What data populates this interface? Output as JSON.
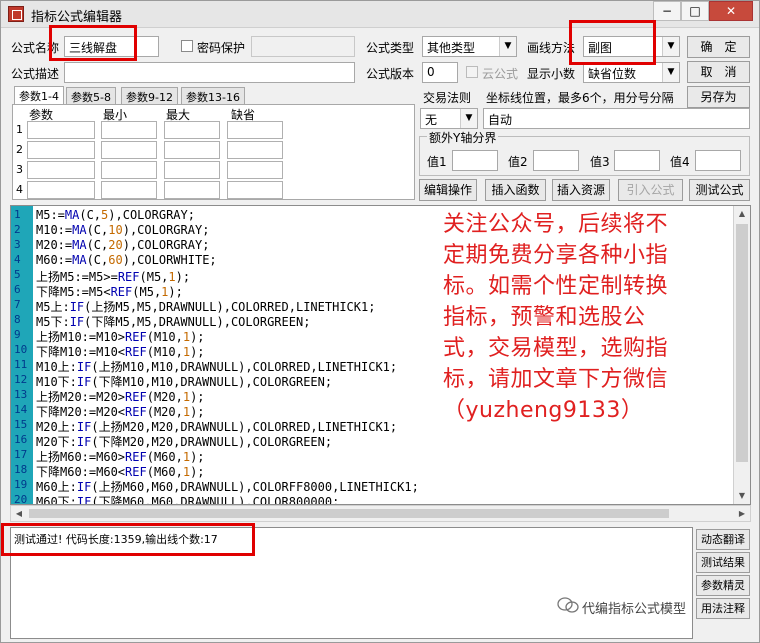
{
  "window": {
    "title": "指标公式编辑器",
    "min": "−",
    "max": "□",
    "close": "✕"
  },
  "form": {
    "name_label": "公式名称",
    "name_value": "三线解盘",
    "password_label": "密码保护",
    "type_label": "公式类型",
    "type_value": "其他类型",
    "draw_label": "画线方法",
    "draw_value": "副图",
    "ok": "确　定",
    "cancel": "取　消",
    "desc_label": "公式描述",
    "version_label": "公式版本",
    "version_value": "0",
    "cloud_label": "云公式",
    "decimals_label": "显示小数",
    "decimals_value": "缺省位数",
    "save_as": "另存为",
    "trade_rule_label": "交易法则",
    "coord_label": "坐标线位置，最多6个，用分号分隔",
    "trade_rule_value": "无",
    "coord_value": "自动",
    "extra_axis_label": "额外Y轴分界",
    "axis_vals": [
      "值1",
      "值2",
      "值3",
      "值4"
    ]
  },
  "tabs": [
    "参数1-4",
    "参数5-8",
    "参数9-12",
    "参数13-16"
  ],
  "params": {
    "headers": [
      "参数",
      "最小",
      "最大",
      "缺省"
    ],
    "rows": [
      "1",
      "2",
      "3",
      "4"
    ]
  },
  "actions": [
    "编辑操作",
    "插入函数",
    "插入资源",
    "引入公式",
    "测试公式"
  ],
  "code_lines": [
    [
      "M5:=",
      "MA",
      "(C,",
      "5",
      "),COLORGRAY;"
    ],
    [
      "M10:=",
      "MA",
      "(C,",
      "10",
      "),COLORGRAY;"
    ],
    [
      "M20:=",
      "MA",
      "(C,",
      "20",
      "),COLORGRAY;"
    ],
    [
      "M60:=",
      "MA",
      "(C,",
      "60",
      "),COLORWHITE;"
    ],
    [
      "上扬M5:=M5>=",
      "REF",
      "(M5,",
      "1",
      ");"
    ],
    [
      "下降M5:=M5<",
      "REF",
      "(M5,",
      "1",
      ");"
    ],
    [
      "M5上:",
      "IF",
      "(上扬M5,M5,DRAWNULL),COLORRED,LINETHICK1;",
      "",
      ""
    ],
    [
      "M5下:",
      "IF",
      "(下降M5,M5,DRAWNULL),COLORGREEN;",
      "",
      ""
    ],
    [
      "上扬M10:=M10>",
      "REF",
      "(M10,",
      "1",
      ");"
    ],
    [
      "下降M10:=M10<",
      "REF",
      "(M10,",
      "1",
      ");"
    ],
    [
      "M10上:",
      "IF",
      "(上扬M10,M10,DRAWNULL),COLORRED,LINETHICK1;",
      "",
      ""
    ],
    [
      "M10下:",
      "IF",
      "(下降M10,M10,DRAWNULL),COLORGREEN;",
      "",
      ""
    ],
    [
      "上扬M20:=M20>",
      "REF",
      "(M20,",
      "1",
      ");"
    ],
    [
      "下降M20:=M20<",
      "REF",
      "(M20,",
      "1",
      ");"
    ],
    [
      "M20上:",
      "IF",
      "(上扬M20,M20,DRAWNULL),COLORRED,LINETHICK1;",
      "",
      ""
    ],
    [
      "M20下:",
      "IF",
      "(下降M20,M20,DRAWNULL),COLORGREEN;",
      "",
      ""
    ],
    [
      "上扬M60:=M60>",
      "REF",
      "(M60,",
      "1",
      ");"
    ],
    [
      "下降M60:=M60<",
      "REF",
      "(M60,",
      "1",
      ");"
    ],
    [
      "M60上:",
      "IF",
      "(上扬M60,M60,DRAWNULL),COLORFF8000,LINETHICK1;",
      "",
      ""
    ],
    [
      "M60下:",
      "IF",
      "(下降M60,M60,DRAWNULL),COLOR800000;",
      "",
      ""
    ]
  ],
  "overlay_lines": [
    "关注公众号，后续将不",
    "定期免费分享各种小指",
    "标。如需个性定制转换",
    "指标，预警和选股公",
    "式，交易模型，选购指",
    "标，请加文章下方微信",
    "（yuzheng9133）"
  ],
  "output_text": "测试通过! 代码长度:1359,输出线个数:17",
  "right_buttons": [
    "动态翻译",
    "测试结果",
    "参数精灵",
    "用法注释"
  ],
  "watermark": "代编指标公式模型",
  "colors": {
    "gutter": "#1fa6b8",
    "overlay_text": "#e02020",
    "highlight_box": "#e00000"
  }
}
